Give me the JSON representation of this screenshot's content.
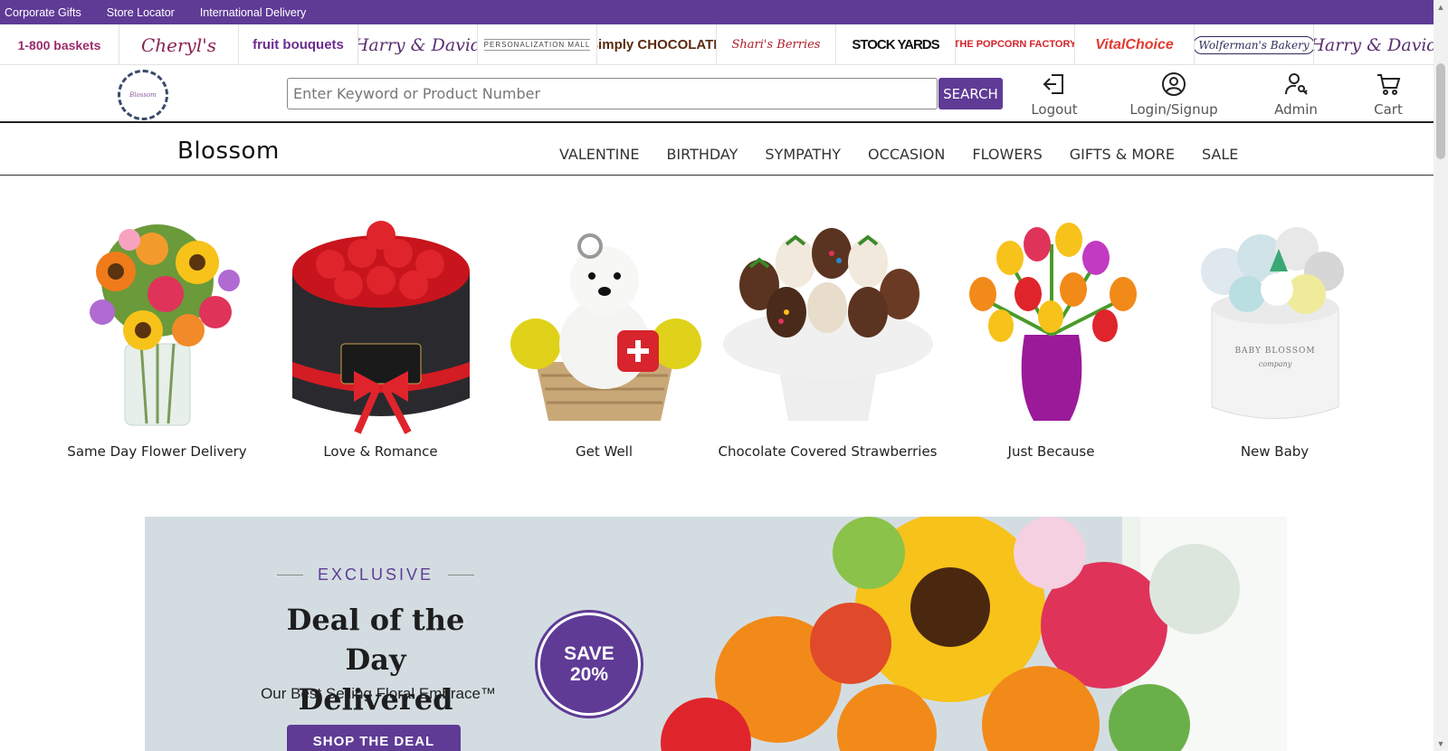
{
  "topbar": {
    "links": [
      "Corporate Gifts",
      "Store Locator",
      "International Delivery"
    ]
  },
  "brands": [
    "1-800 baskets",
    "Cheryl's",
    "fruit bouquets",
    "Harry & David",
    "PERSONALIZATION MALL",
    "simply CHOCOLATE",
    "Shari's Berries",
    "STOCK YARDS",
    "THE POPCORN FACTORY",
    "VitalChoice",
    "Wolferman's Bakery",
    "Harry & David"
  ],
  "header": {
    "logo_text": "Blossom",
    "search_placeholder": "Enter Keyword or Product Number",
    "search_button": "SEARCH",
    "logout_label": "Logout",
    "login_label": "Login/Signup",
    "admin_label": "Admin",
    "cart_label": "Cart"
  },
  "nav": {
    "site_title": "Blossom",
    "links": [
      "VALENTINE",
      "BIRTHDAY",
      "SYMPATHY",
      "OCCASION",
      "FLOWERS",
      "GIFTS & MORE",
      "SALE"
    ]
  },
  "categories": [
    {
      "label": "Same Day Flower Delivery",
      "image": "bouquet-in-vase"
    },
    {
      "label": "Love & Romance",
      "image": "red-roses-in-box"
    },
    {
      "label": "Get Well",
      "image": "flower-puppy-basket"
    },
    {
      "label": "Chocolate Covered Strawberries",
      "image": "strawberries-on-stand"
    },
    {
      "label": "Just Because",
      "image": "tulips-in-vase"
    },
    {
      "label": "New Baby",
      "image": "baby-clothes-box"
    }
  ],
  "banner": {
    "eyebrow": "EXCLUSIVE",
    "title_line1": "Deal of the Day",
    "title_line2": "Delivered Today",
    "subtitle": "Our Best Selling Floral Embrace™",
    "button": "SHOP THE DEAL",
    "badge_line1": "SAVE",
    "badge_line2": "20%"
  },
  "colors": {
    "brand_purple": "#5f3b96",
    "banner_bg": "#d3dde1"
  }
}
